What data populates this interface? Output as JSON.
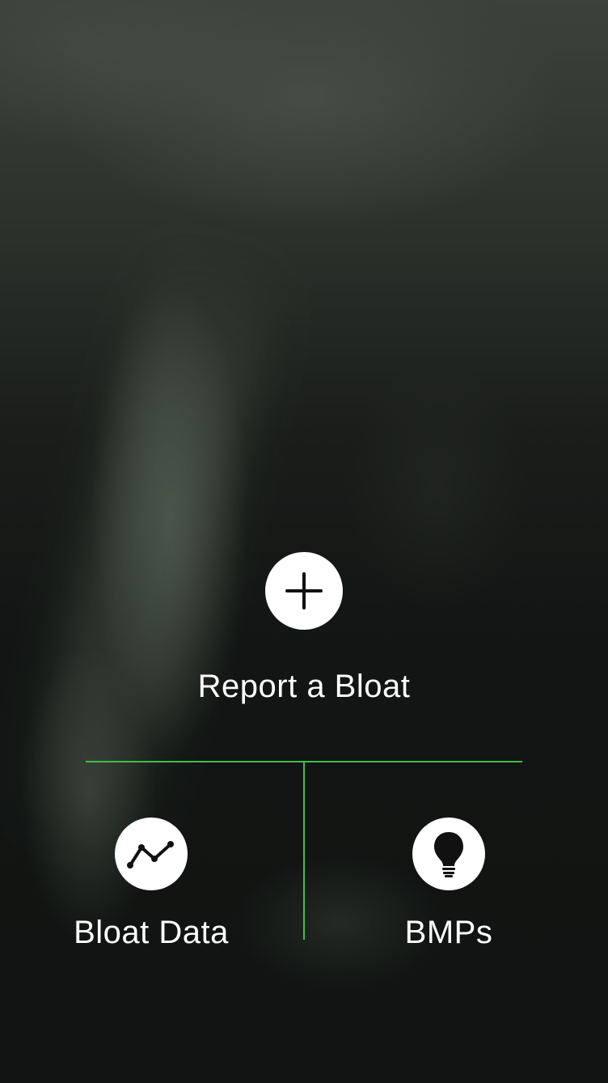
{
  "actions": {
    "primary": {
      "label": "Report a Bloat",
      "icon": "plus-icon"
    },
    "secondary": [
      {
        "label": "Bloat Data",
        "icon": "line-chart-icon"
      },
      {
        "label": "BMPs",
        "icon": "lightbulb-icon"
      }
    ]
  },
  "colors": {
    "accent": "#3fbf4a",
    "icon_background": "#ffffff",
    "icon_foreground": "#111111",
    "text": "#ffffff"
  }
}
